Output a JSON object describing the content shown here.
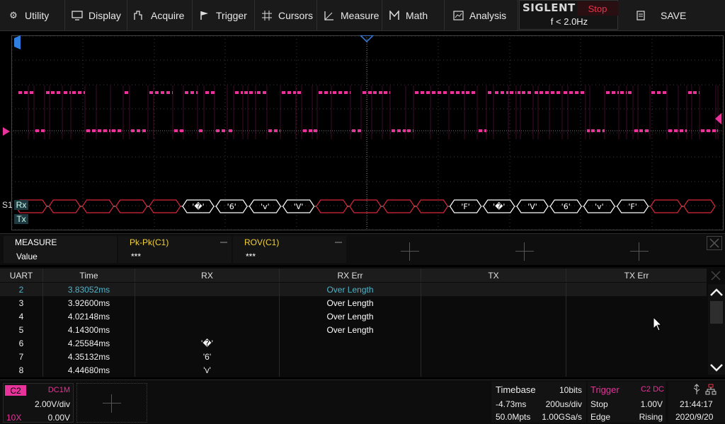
{
  "menu": [
    {
      "label": "Utility",
      "icon": "gear-icon"
    },
    {
      "label": "Display",
      "icon": "monitor-icon"
    },
    {
      "label": "Acquire",
      "icon": "acquire-icon"
    },
    {
      "label": "Trigger",
      "icon": "flag-icon"
    },
    {
      "label": "Cursors",
      "icon": "crosshair-icon"
    },
    {
      "label": "Measure",
      "icon": "ruler-icon"
    },
    {
      "label": "Math",
      "icon": "math-icon"
    },
    {
      "label": "Analysis",
      "icon": "chart-icon"
    }
  ],
  "brand": "SIGLENT",
  "run_state": "Stop",
  "trigger_freq": "f < 2.0Hz",
  "save_label": "SAVE",
  "decode": {
    "bus_label": "S1",
    "rx_label": "Rx",
    "tx_label": "Tx",
    "frames": [
      "",
      "",
      "",
      "",
      "",
      "'�'",
      "'6'",
      "'v'",
      "'V'",
      "",
      "",
      "",
      "",
      "'F'",
      "'�'",
      "'V'",
      "'6'",
      "'v'",
      "'F'",
      "",
      ""
    ]
  },
  "measure": {
    "title": "MEASURE",
    "value_label": "Value",
    "items": [
      {
        "name": "Pk-Pk(C1)",
        "value": "***"
      },
      {
        "name": "ROV(C1)",
        "value": "***"
      }
    ]
  },
  "table": {
    "headers": [
      "UART",
      "Time",
      "RX",
      "RX Err",
      "TX",
      "TX Err"
    ],
    "rows": [
      [
        "2",
        "3.83052ms",
        "",
        "Over Length",
        "",
        ""
      ],
      [
        "3",
        "3.92600ms",
        "",
        "Over Length",
        "",
        ""
      ],
      [
        "4",
        "4.02148ms",
        "",
        "Over Length",
        "",
        ""
      ],
      [
        "5",
        "4.14300ms",
        "",
        "Over Length",
        "",
        ""
      ],
      [
        "6",
        "4.25584ms",
        "'�'",
        "",
        "",
        ""
      ],
      [
        "7",
        "4.35132ms",
        "'6'",
        "",
        "",
        ""
      ],
      [
        "8",
        "4.44680ms",
        "'v'",
        "",
        "",
        ""
      ]
    ]
  },
  "channel": {
    "name": "C2",
    "coupling": "DC1M",
    "scale": "2.00V/div",
    "probe": "10X",
    "offset": "0.00V",
    "color": "#e8339a"
  },
  "timebase": {
    "label": "Timebase",
    "bits": "10bits",
    "delay": "-4.73ms",
    "scale": "200us/div",
    "memory": "50.0Mpts",
    "sample_rate": "1.00GSa/s"
  },
  "trigger": {
    "label": "Trigger",
    "source": "C2 DC",
    "mode": "Stop",
    "level": "1.00V",
    "type": "Edge",
    "slope": "Rising"
  },
  "clock": {
    "time": "21:44:17",
    "date": "2020/9/20"
  }
}
